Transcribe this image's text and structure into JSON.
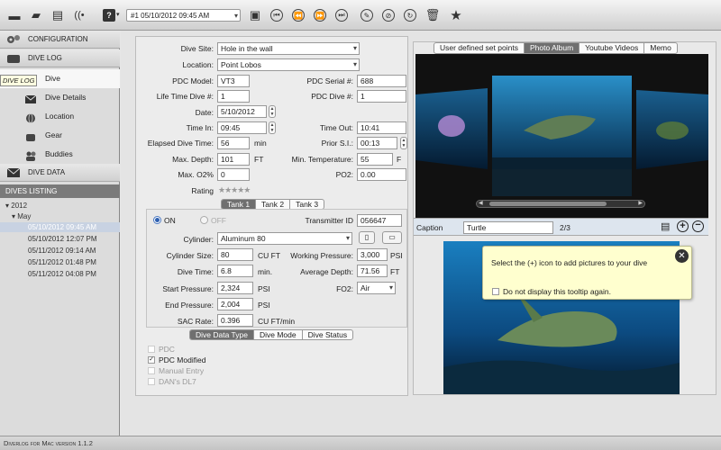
{
  "toolbar": {
    "dive_select": "#1 05/10/2012 09:45 AM",
    "help_label": "?"
  },
  "sidebar": {
    "configuration": "CONFIGURATION",
    "dive_log": "DIVE LOG",
    "tooltip": "DIVE LOG",
    "items": [
      {
        "label": "Dive",
        "icon": "dive-icon"
      },
      {
        "label": "Dive Details",
        "icon": "envelope-icon"
      },
      {
        "label": "Location",
        "icon": "globe-icon"
      },
      {
        "label": "Gear",
        "icon": "gear-icon"
      },
      {
        "label": "Buddies",
        "icon": "people-icon"
      }
    ],
    "dive_data": "DIVE DATA",
    "listing_header": "DIVES LISTING",
    "tree": {
      "year": "2012",
      "month": "May",
      "dives": [
        "05/10/2012 09:45 AM",
        "05/10/2012 12:07 PM",
        "05/11/2012 09:14 AM",
        "05/11/2012 01:48 PM",
        "05/11/2012 04:08 PM"
      ]
    }
  },
  "status_bar": "Diverlog for Mac version 1.1.2",
  "form": {
    "dive_site_label": "Dive Site:",
    "dive_site": "Hole in the wall",
    "location_label": "Location:",
    "location": "Point Lobos",
    "pdc_model_label": "PDC Model:",
    "pdc_model": "VT3",
    "pdc_serial_label": "PDC Serial #:",
    "pdc_serial": "688",
    "lifetime_dive_label": "Life Time Dive #:",
    "lifetime_dive": "1",
    "pdc_dive_label": "PDC Dive #:",
    "pdc_dive": "1",
    "date_label": "Date:",
    "date": "5/10/2012",
    "time_in_label": "Time In:",
    "time_in": "09:45",
    "time_out_label": "Time Out:",
    "time_out": "10:41",
    "elapsed_label": "Elapsed Dive Time:",
    "elapsed": "56",
    "elapsed_unit": "min",
    "prior_si_label": "Prior S.I.:",
    "prior_si": "00:13",
    "max_depth_label": "Max. Depth:",
    "max_depth": "101",
    "max_depth_unit": "FT",
    "min_temp_label": "Min. Temperature:",
    "min_temp": "55",
    "min_temp_unit": "F",
    "max_o2_label": "Max. O2%",
    "max_o2": "0",
    "po2_label": "PO2:",
    "po2": "0.00",
    "rating_label": "Rating",
    "rating_stars": "★★★★★"
  },
  "tank": {
    "tabs": [
      "Tank 1",
      "Tank 2",
      "Tank 3"
    ],
    "on_label": "ON",
    "off_label": "OFF",
    "transmitter_label": "Transmitter ID",
    "transmitter": "056647",
    "cylinder_label": "Cylinder:",
    "cylinder": "Aluminum 80",
    "cyl_size_label": "Cylinder Size:",
    "cyl_size": "80",
    "cyl_size_unit": "CU FT",
    "working_pressure_label": "Working Pressure:",
    "working_pressure": "3,000",
    "working_pressure_unit": "PSI",
    "dive_time_label": "Dive Time:",
    "dive_time": "6.8",
    "dive_time_unit": "min.",
    "avg_depth_label": "Average Depth:",
    "avg_depth": "71.56",
    "avg_depth_unit": "FT",
    "start_pressure_label": "Start Pressure:",
    "start_pressure": "2,324",
    "start_pressure_unit": "PSI",
    "fo2_label": "FO2:",
    "fo2": "Air",
    "end_pressure_label": "End Pressure:",
    "end_pressure": "2,004",
    "end_pressure_unit": "PSI",
    "sac_label": "SAC Rate:",
    "sac": "0.396",
    "sac_unit": "CU FT/min"
  },
  "data_type": {
    "tabs": [
      "Dive Data Type",
      "Dive Mode",
      "Dive Status"
    ],
    "options": [
      {
        "label": "PDC",
        "checked": false
      },
      {
        "label": "PDC Modified",
        "checked": true
      },
      {
        "label": "Manual Entry",
        "checked": false
      },
      {
        "label": "DAN's DL7",
        "checked": false
      }
    ]
  },
  "right": {
    "tabs": [
      "User defined set points",
      "Photo Album",
      "Youtube Videos",
      "Memo"
    ],
    "caption_label": "Caption",
    "caption": "Turtle",
    "counter": "2/3",
    "tip_text": "Select the (+) icon to add pictures to your dive",
    "tip_checkbox": "Do not display this tooltip again."
  },
  "colors": {
    "accent": "#6f6f6f",
    "ocean": "#0d4a7a",
    "tooltip_bg": "#ffffcf"
  }
}
